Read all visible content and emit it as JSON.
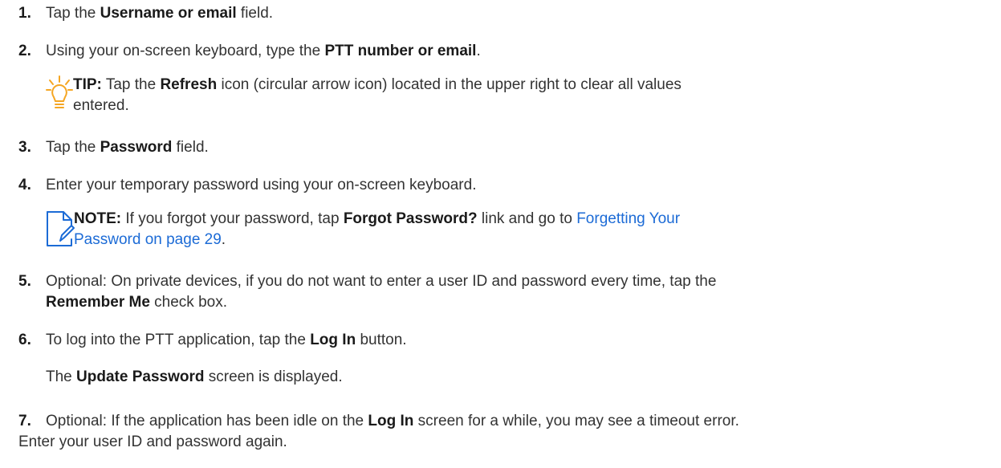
{
  "steps": [
    {
      "num": "1.",
      "pre": "Tap the ",
      "bold": "Username or email",
      "post": " field."
    },
    {
      "num": "2.",
      "pre": "Using your on-screen keyboard, type the ",
      "bold": "PTT number or email",
      "post": "."
    },
    {
      "num": "3.",
      "pre": "Tap the ",
      "bold": "Password",
      "post": " field."
    },
    {
      "num": "4.",
      "text": "Enter your temporary password using your on-screen keyboard."
    },
    {
      "num": "5.",
      "line1": "Optional: On private devices, if you do not want to enter a user ID and password every time, tap the",
      "bold": "Remember Me",
      "post": " check box."
    },
    {
      "num": "6.",
      "pre": "To log into the PTT application, tap the ",
      "bold": "Log In",
      "post": " button."
    },
    {
      "num": "7.",
      "pre": "Optional: If the application has been idle on the ",
      "bold": "Log In",
      "post": " screen for a while, you may see a timeout error.",
      "line2": "Enter your user ID and password again."
    }
  ],
  "tip": {
    "icon": "lightbulb-icon",
    "label": "TIP:",
    "pre": " Tap the ",
    "bold": "Refresh",
    "post": " icon (circular arrow icon) located in the upper right to clear all values",
    "line2": "entered."
  },
  "note": {
    "icon": "note-pencil-icon",
    "label": "NOTE:",
    "pre": " If you forgot your password, tap ",
    "bold": "Forgot Password?",
    "mid": " link and go to ",
    "link_line1": "Forgetting Your",
    "link_line2": "Password on page 29",
    "post": "."
  },
  "result6": {
    "pre": "The ",
    "bold": "Update Password",
    "post": " screen is displayed."
  },
  "colors": {
    "accent_tip": "#f5a623",
    "accent_note": "#1c6bd6",
    "link": "#1c6bd6"
  }
}
